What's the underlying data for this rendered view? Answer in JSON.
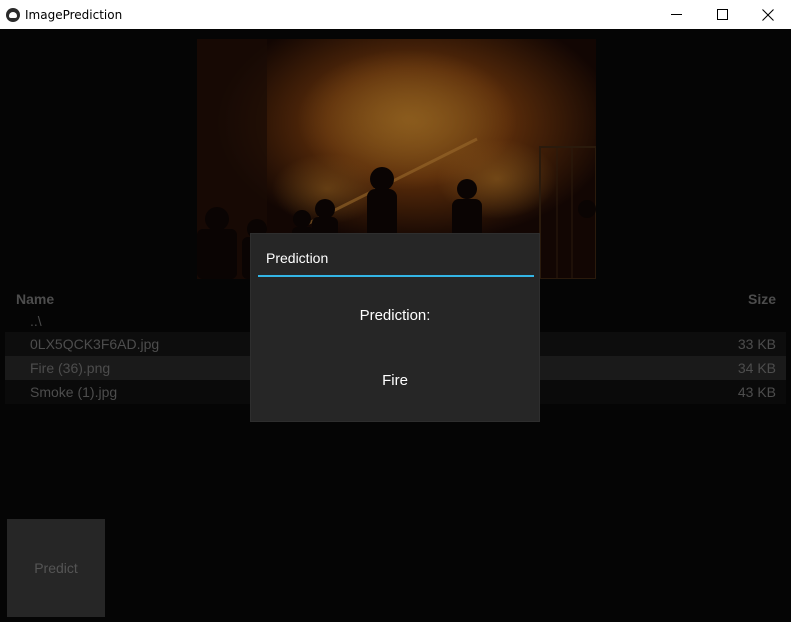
{
  "window": {
    "title": "ImagePrediction",
    "icons": {
      "app": "app-logo-icon",
      "minimize": "minimize-icon",
      "maximize": "maximize-icon",
      "close": "close-icon"
    }
  },
  "file_browser": {
    "columns": {
      "name": "Name",
      "size": "Size"
    },
    "parent_dir": "..\\",
    "files": [
      {
        "name": "0LX5QCK3F6AD.jpg",
        "size": "33 KB"
      },
      {
        "name": "Fire (36).png",
        "size": "34 KB"
      },
      {
        "name": "Smoke (1).jpg",
        "size": "43 KB"
      }
    ],
    "selected_index": 1
  },
  "actions": {
    "predict_label": "Predict"
  },
  "popup": {
    "title": "Prediction",
    "label": "Prediction:",
    "result": "Fire",
    "accent_color": "#33b5e5"
  }
}
